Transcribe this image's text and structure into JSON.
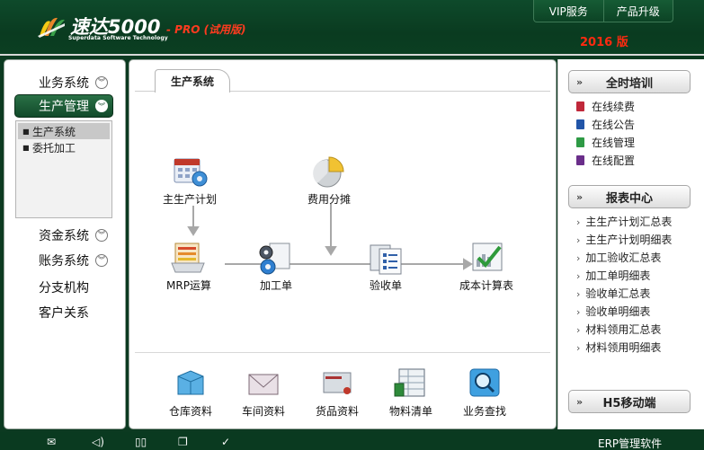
{
  "header": {
    "brand": "速达5000",
    "edition": "- PRO (试用版)",
    "tagline": "Superdata Software Technology",
    "year_badge": "2016 版",
    "nav": [
      "VIP服务",
      "产品升级"
    ]
  },
  "sidebar": {
    "items": [
      {
        "label": "业务系统",
        "chevron": "double-chevron-down-icon"
      },
      {
        "label": "生产管理",
        "chevron": "double-chevron-down-icon",
        "active": true
      },
      {
        "label": "资金系统",
        "chevron": "double-chevron-down-icon"
      },
      {
        "label": "账务系统",
        "chevron": "double-chevron-down-icon"
      },
      {
        "label": "分支机构"
      },
      {
        "label": "客户关系"
      }
    ],
    "submenu": [
      {
        "label": "生产系统",
        "selected": true
      },
      {
        "label": "委托加工",
        "selected": false
      }
    ]
  },
  "main": {
    "tab": "生产系统",
    "flow_nodes": [
      {
        "label": "主生产计划",
        "icon": "calendar-gear-icon"
      },
      {
        "label": "费用分摊",
        "icon": "pie-chart-icon"
      },
      {
        "label": "MRP运算",
        "icon": "stacked-folders-icon"
      },
      {
        "label": "加工单",
        "icon": "gears-document-icon"
      },
      {
        "label": "验收单",
        "icon": "checklist-icon"
      },
      {
        "label": "成本计算表",
        "icon": "chart-check-icon"
      }
    ],
    "bottom_items": [
      {
        "label": "仓库资料",
        "icon": "warehouse-box-icon"
      },
      {
        "label": "车间资料",
        "icon": "envelope-icon"
      },
      {
        "label": "货品资料",
        "icon": "parcel-icon"
      },
      {
        "label": "物料清单",
        "icon": "spreadsheet-icon"
      },
      {
        "label": "业务查找",
        "icon": "magnifier-icon"
      }
    ]
  },
  "right": {
    "training_title": "全时培训",
    "training_links": [
      {
        "label": "在线续费",
        "color": "#c0283a"
      },
      {
        "label": "在线公告",
        "color": "#2255a8"
      },
      {
        "label": "在线管理",
        "color": "#2e9a45"
      },
      {
        "label": "在线配置",
        "color": "#6a2e8a"
      }
    ],
    "reports_title": "报表中心",
    "reports": [
      "主生产计划汇总表",
      "主生产计划明细表",
      "加工验收汇总表",
      "加工单明细表",
      "验收单汇总表",
      "验收单明细表",
      "材料领用汇总表",
      "材料领用明细表"
    ],
    "mobile_title": "H5移动端"
  },
  "footer": {
    "icons": [
      "mail-icon",
      "speaker-icon",
      "book-icon",
      "copy-icon",
      "check-circle-icon"
    ],
    "text": "ERP管理软件"
  },
  "colors": {
    "header_green": "#0e4a2b",
    "accent_red": "#ff2a10",
    "active_menu": "#1d5e38"
  }
}
